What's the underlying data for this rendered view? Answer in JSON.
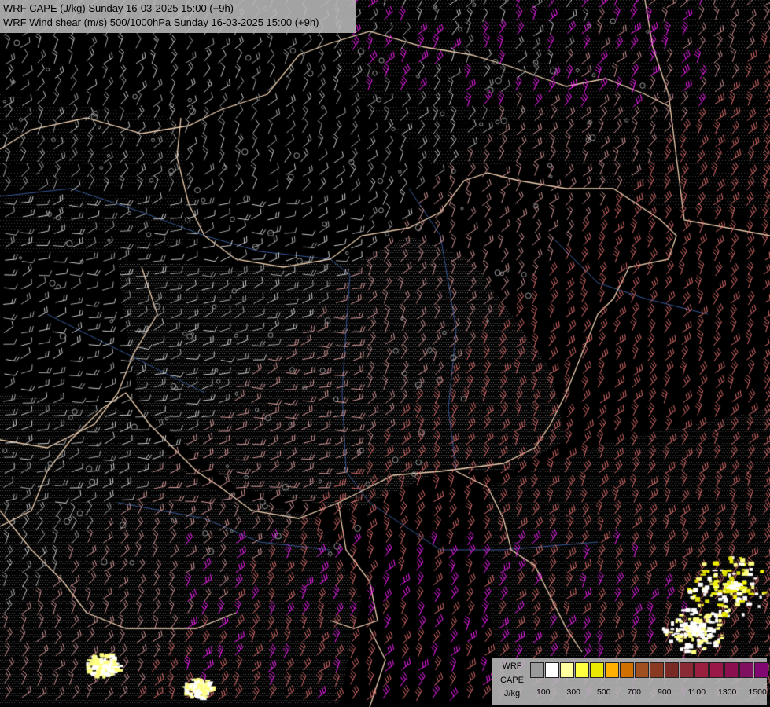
{
  "header": {
    "line1": "WRF CAPE (J/kg) Sunday 16-03-2025 15:00 (+9h)",
    "line2": "WRF Wind shear (m/s) 500/1000hPa Sunday 16-03-2025 15:00 (+9h)"
  },
  "legend": {
    "label_line1": "WRF",
    "label_line2": "CAPE",
    "label_line3": "J/kg",
    "colors": [
      "#9a9a9a",
      "#ffffff",
      "#ffffa0",
      "#ffff40",
      "#e8e800",
      "#ffb000",
      "#d07000",
      "#a05020",
      "#8a3a20",
      "#7a2a25",
      "#8a2a35",
      "#9a2040",
      "#9a1848",
      "#8a1050",
      "#801060",
      "#800870",
      "#800080"
    ],
    "tick_labels": [
      "100",
      "300",
      "500",
      "700",
      "900",
      "1100",
      "1300",
      "1500"
    ]
  },
  "map": {
    "wind_colors": {
      "light": "#cfcfcf",
      "grey": "#a8a8a8",
      "pink": "#d89a9a",
      "salmon": "#e07070",
      "magenta": "#ff20ff"
    },
    "border_color": "#f0d0b0",
    "river_color": "#3a5a9a"
  }
}
